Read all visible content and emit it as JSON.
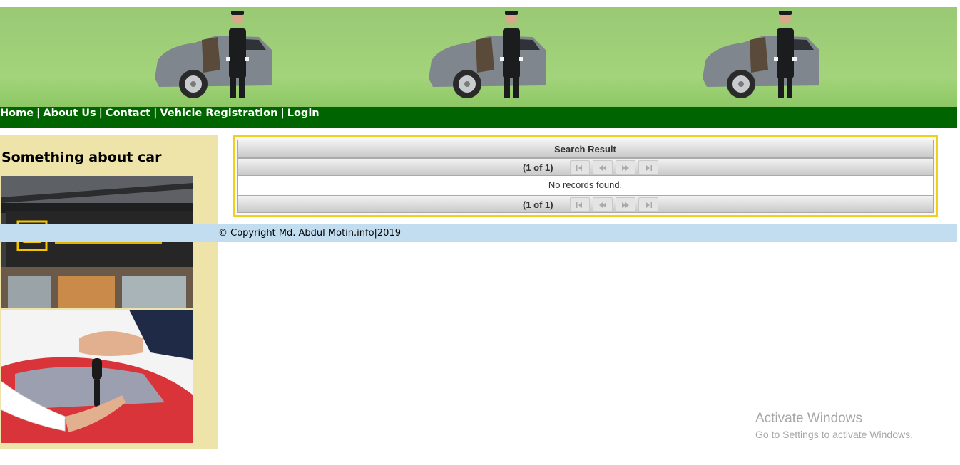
{
  "nav": {
    "items": [
      "Home",
      "About Us",
      "Contact",
      "Vehicle Registration",
      "Login"
    ],
    "separator": "|"
  },
  "sidebar": {
    "title": "Something about car",
    "images": [
      "car-rental-sign-image",
      "car-keys-handover-image"
    ]
  },
  "results": {
    "header": "Search Result",
    "page_label_top": "(1 of 1)",
    "page_label_bottom": "(1 of 1)",
    "empty_message": "No records found.",
    "paging_icons": [
      "first-page-icon",
      "previous-page-icon",
      "next-page-icon",
      "last-page-icon"
    ]
  },
  "footer": {
    "text": "© Copyright Md. Abdul Motin.info|2019"
  },
  "watermark": {
    "line1": "Activate Windows",
    "line2": "Go to Settings to activate Windows."
  },
  "colors": {
    "nav_bg": "#006400",
    "banner_bg": "#a3d47b",
    "sidebar_bg": "#eee4a9",
    "panel_border": "#f2cf1b",
    "footer_bg": "#c1ddef"
  }
}
